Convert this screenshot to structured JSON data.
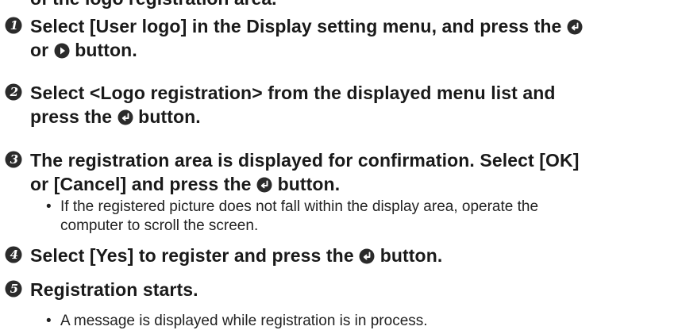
{
  "clipped_top_text": "of the logo registration area.",
  "steps": [
    {
      "number": "1",
      "lines": [
        "Select [User logo] in the Display setting menu, and press the",
        "or",
        "button."
      ]
    },
    {
      "number": "2",
      "lines": [
        "Select <Logo registration> from the displayed menu list and",
        "press the",
        "button."
      ]
    },
    {
      "number": "3",
      "lines": [
        "The registration area is displayed for confirmation. Select [OK]",
        "or [Cancel] and press the",
        "button."
      ],
      "bullets": [
        "If the registered picture does not fall within the display area, operate the",
        "computer to scroll the screen."
      ]
    },
    {
      "number": "4",
      "lines": [
        "Select [Yes] to register and press the",
        "button."
      ]
    },
    {
      "number": "5",
      "lines": [
        "Registration starts."
      ],
      "bullets": [
        "A message is displayed while registration is in process."
      ]
    }
  ],
  "bullet_glyph": "•",
  "icons": {
    "step_badge": "numbered-circle-icon",
    "enter": "enter-button-icon",
    "right": "right-button-icon"
  }
}
